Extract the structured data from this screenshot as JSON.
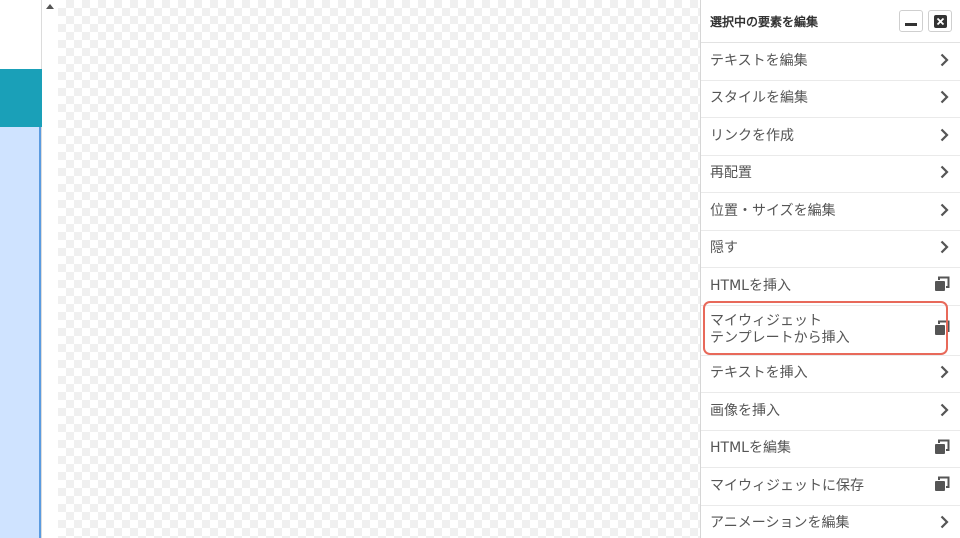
{
  "panel": {
    "title": "選択中の要素を編集",
    "minimize_icon": "minimize-icon",
    "close_icon": "close-icon",
    "items": [
      {
        "label": "テキストを編集",
        "icon": "chevron-right-icon"
      },
      {
        "label": "スタイルを編集",
        "icon": "chevron-right-icon"
      },
      {
        "label": "リンクを作成",
        "icon": "chevron-right-icon"
      },
      {
        "label": "再配置",
        "icon": "chevron-right-icon"
      },
      {
        "label": "位置・サイズを編集",
        "icon": "chevron-right-icon"
      },
      {
        "label": "隠す",
        "icon": "chevron-right-icon"
      },
      {
        "label": "HTMLを挿入",
        "icon": "copy-icon"
      },
      {
        "label": "マイウィジェット\nテンプレートから挿入",
        "icon": "copy-icon"
      },
      {
        "label": "テキストを挿入",
        "icon": "chevron-right-icon"
      },
      {
        "label": "画像を挿入",
        "icon": "chevron-right-icon"
      },
      {
        "label": "HTMLを編集",
        "icon": "copy-icon"
      },
      {
        "label": "マイウィジェットに保存",
        "icon": "copy-icon"
      },
      {
        "label": "アニメーションを編集",
        "icon": "chevron-right-icon"
      }
    ]
  },
  "colors": {
    "accent_teal": "#1aa0b8",
    "selection_blue": "#cfe3ff",
    "highlight_red": "#e8695a"
  }
}
